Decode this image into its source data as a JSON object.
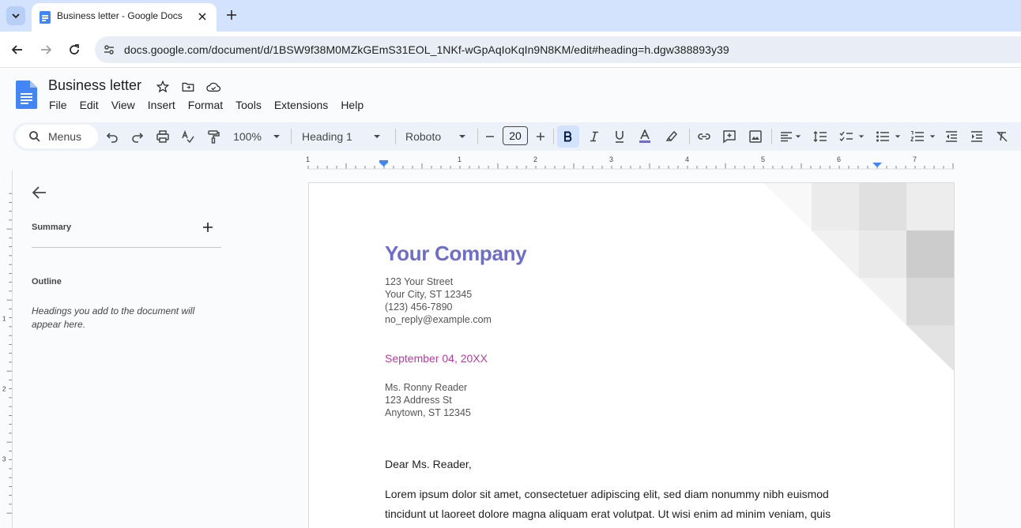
{
  "browser": {
    "tab_title": "Business letter - Google Docs",
    "url": "docs.google.com/document/d/1BSW9f38M0MZkGEmS31EOL_1NKf-wGpAqIoKqIn9N8KM/edit#heading=h.dgw388893y39"
  },
  "doc": {
    "title": "Business letter",
    "menus": [
      "File",
      "Edit",
      "View",
      "Insert",
      "Format",
      "Tools",
      "Extensions",
      "Help"
    ]
  },
  "toolbar": {
    "menus_search": "Menus",
    "zoom": "100%",
    "style": "Heading 1",
    "font": "Roboto",
    "font_size": "20"
  },
  "ruler": {
    "top_labels": [
      "1",
      "1",
      "2",
      "3",
      "4",
      "5",
      "6",
      "7"
    ],
    "left_labels": [
      "1",
      "2",
      "3"
    ]
  },
  "outline": {
    "summary_label": "Summary",
    "outline_label": "Outline",
    "hint": "Headings you add to the document will appear here."
  },
  "letter": {
    "company": "Your Company",
    "sender_lines": [
      "123 Your Street",
      "Your City, ST 12345",
      "(123) 456-7890",
      "no_reply@example.com"
    ],
    "date": "September 04, 20XX",
    "recipient_lines": [
      "Ms. Ronny Reader",
      "123 Address St",
      "Anytown, ST 12345"
    ],
    "salutation": "Dear Ms. Reader,",
    "body_lines": [
      "Lorem ipsum dolor sit amet, consectetuer adipiscing elit, sed diam nonummy nibh euismod",
      "tincidunt ut laoreet dolore magna aliquam erat volutpat. Ut wisi enim ad minim veniam, quis"
    ]
  },
  "colors": {
    "company": "#6e6ec8",
    "date": "#b63d9a",
    "tabstrip": "#d3e3fd",
    "toolbar": "#edf2fa"
  }
}
